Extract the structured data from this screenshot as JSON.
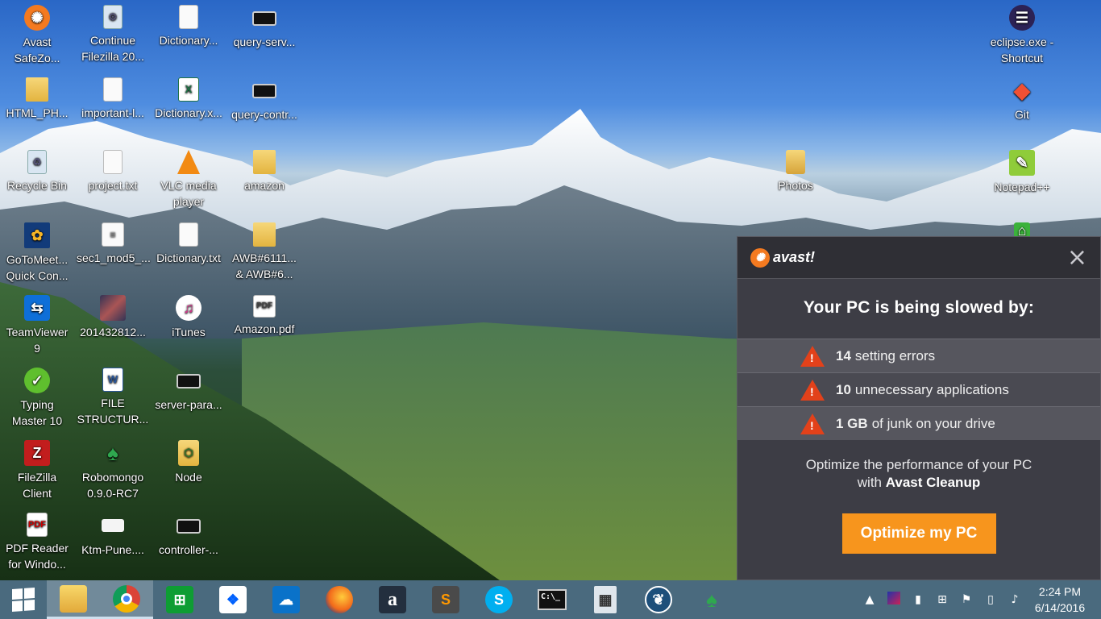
{
  "desktop": {
    "icons": [
      {
        "label": "Avast\nSafeZo...",
        "icon": "avast-icon"
      },
      {
        "label": "Continue\nFilezilla 20...",
        "icon": "filezilla-install-icon"
      },
      {
        "label": "Dictionary...",
        "icon": "text-document-icon"
      },
      {
        "label": "query-serv...",
        "icon": "command-prompt-icon"
      },
      {
        "label": "HTML_PH...",
        "icon": "folder-icon"
      },
      {
        "label": "important-l...",
        "icon": "text-document-icon"
      },
      {
        "label": "Dictionary.x...",
        "icon": "excel-icon"
      },
      {
        "label": "query-contr...",
        "icon": "command-prompt-icon"
      },
      {
        "label": "Recycle Bin",
        "icon": "recycle-bin-icon"
      },
      {
        "label": "project.txt",
        "icon": "text-document-icon"
      },
      {
        "label": "VLC media\nplayer",
        "icon": "vlc-icon"
      },
      {
        "label": "amazon",
        "icon": "folder-icon"
      },
      {
        "label": "GoToMeet...\nQuick Con...",
        "icon": "gotomeeting-icon"
      },
      {
        "label": "sec1_mod5_...",
        "icon": "document-icon"
      },
      {
        "label": "Dictionary.txt",
        "icon": "text-document-icon"
      },
      {
        "label": "AWB#6111...\n& AWB#6...",
        "icon": "folder-icon"
      },
      {
        "label": "TeamViewer\n9",
        "icon": "teamviewer-icon"
      },
      {
        "label": "201432812...",
        "icon": "image-icon"
      },
      {
        "label": "iTunes",
        "icon": "itunes-icon"
      },
      {
        "label": "Amazon.pdf",
        "icon": "pdf-document-icon"
      },
      {
        "label": "Typing\nMaster 10",
        "icon": "typing-master-icon"
      },
      {
        "label": "FILE\nSTRUCTUR...",
        "icon": "word-icon"
      },
      {
        "label": "server-para...",
        "icon": "command-prompt-icon"
      },
      {
        "label": "FileZilla\nClient",
        "icon": "filezilla-icon"
      },
      {
        "label": "Robomongo\n0.9.0-RC7",
        "icon": "robomongo-icon"
      },
      {
        "label": "Node",
        "icon": "node-folder-icon"
      },
      {
        "label": "PDF Reader\nfor Windo...",
        "icon": "pdf-reader-icon"
      },
      {
        "label": "Ktm-Pune....",
        "icon": "ticket-icon"
      },
      {
        "label": "controller-...",
        "icon": "command-prompt-icon"
      },
      {
        "label": "Photos",
        "icon": "photos-folder-icon"
      },
      {
        "label": "eclipse.exe -\nShortcut",
        "icon": "eclipse-icon"
      },
      {
        "label": "Git",
        "icon": "git-icon"
      },
      {
        "label": "Notepad++",
        "icon": "notepad-plus-plus-icon"
      }
    ]
  },
  "popup": {
    "brand": "avast!",
    "close": "×",
    "title": "Your PC is being slowed by:",
    "issues": [
      {
        "count": "14",
        "text": "setting errors"
      },
      {
        "count": "10",
        "text": "unnecessary applications"
      },
      {
        "count": "1 GB",
        "text": "of junk on your drive"
      }
    ],
    "promo_line1": "Optimize the performance of your PC",
    "promo_with": "with",
    "promo_product": "Avast Cleanup",
    "button": "Optimize my PC",
    "colors": {
      "accent": "#f7951d",
      "warning": "#e2411a",
      "panel": "#3d3d45"
    }
  },
  "taskbar": {
    "apps": [
      "start-icon",
      "file-explorer-icon",
      "chrome-icon",
      "store-icon",
      "dropbox-icon",
      "onedrive-icon",
      "firefox-icon",
      "amazon-icon",
      "sublime-text-icon",
      "skype-icon",
      "command-prompt-icon",
      "calculator-icon",
      "sourcetree-icon",
      "robomongo-icon"
    ],
    "store_glyph": "⊞",
    "amazon_glyph": "a",
    "sublime_glyph": "S",
    "skype_glyph": "S",
    "cmd_glyph": "C:\\_",
    "time": "2:24 PM",
    "date": "6/14/2016"
  }
}
